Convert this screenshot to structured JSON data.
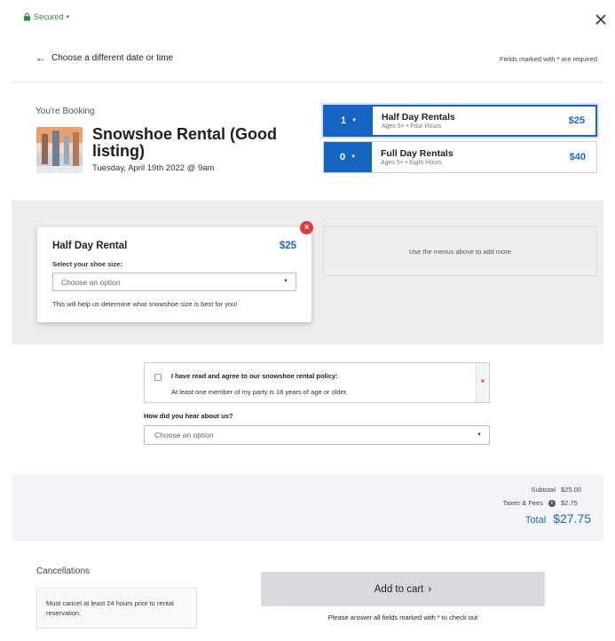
{
  "header": {
    "secured_label": "Secured",
    "secured_caret": "▾",
    "close_icon": "close-icon"
  },
  "nav": {
    "back_arrow": "←",
    "back_label": "Choose a different date or time",
    "required_note_pre": "Fields marked with",
    "required_star": "*",
    "required_note_post": "are required"
  },
  "booking": {
    "label": "You're Booking",
    "title": "Snowshoe Rental (Good listing)",
    "date": "Tuesday, April 19th 2022 @ 9am"
  },
  "rentals": [
    {
      "qty": "1",
      "name": "Half Day Rentals",
      "meta": "Ages 5+ • Four Hours",
      "price": "$25",
      "selected": true
    },
    {
      "qty": "0",
      "name": "Full Day Rentals",
      "meta": "Ages 5+ • Eight Hours",
      "price": "$40",
      "selected": false
    }
  ],
  "selected_item": {
    "title": "Half Day Rental",
    "price": "$25",
    "size_label": "Select your shoe size:",
    "size_placeholder": "Choose an option",
    "help": "This will help us determine what snowshoe size is best for you!",
    "remove_symbol": "×"
  },
  "add_more_hint": "Use the menus above to add more",
  "policy": {
    "title": "I have read and agree to our snowshoe rental policy:",
    "subtitle": "At least one member of my party is 18 years of age or older.",
    "required": "*"
  },
  "referral": {
    "label": "How did you hear about us?",
    "placeholder": "Choose an option"
  },
  "totals": {
    "subtotal_label": "Subtotal",
    "subtotal": "$25.00",
    "fees_label": "Taxes & Fees",
    "fees": "$2.75",
    "info_symbol": "i",
    "total_label": "Total",
    "total": "$27.75"
  },
  "cancellation": {
    "title": "Cancellations",
    "text": "Must cancel at least 24 hours prior to rental reservation."
  },
  "checkout": {
    "button_label": "Add to cart",
    "button_arrow": "›",
    "note_pre": "Please answer all fields marked with",
    "note_star": "*",
    "note_post": "to check out"
  },
  "colors": {
    "accent": "#1565c0",
    "price_blue": "#1e64c8",
    "required_red": "#e53935",
    "secure_green": "#2e8b3e"
  }
}
